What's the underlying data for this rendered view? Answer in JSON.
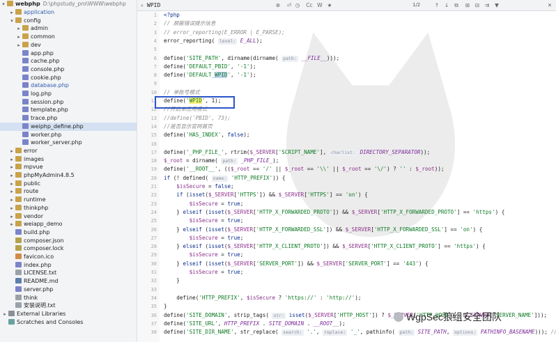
{
  "sidebar": {
    "root": {
      "name": "webphp",
      "path": "D:\\phpstudy_pro\\WWW\\webphp"
    },
    "items": [
      {
        "label": "application",
        "type": "folder",
        "depth": 1,
        "arrow": "▸",
        "blue": true
      },
      {
        "label": "config",
        "type": "folder",
        "depth": 1,
        "arrow": "▾",
        "blue": false
      },
      {
        "label": "admin",
        "type": "folder",
        "depth": 2,
        "arrow": "▸",
        "blue": false
      },
      {
        "label": "common",
        "type": "folder",
        "depth": 2,
        "arrow": "▸",
        "blue": false
      },
      {
        "label": "dev",
        "type": "folder",
        "depth": 2,
        "arrow": "▸",
        "blue": false
      },
      {
        "label": "app.php",
        "type": "php",
        "depth": 2,
        "arrow": "",
        "blue": false
      },
      {
        "label": "cache.php",
        "type": "php",
        "depth": 2,
        "arrow": "",
        "blue": false
      },
      {
        "label": "console.php",
        "type": "php",
        "depth": 2,
        "arrow": "",
        "blue": false
      },
      {
        "label": "cookie.php",
        "type": "php",
        "depth": 2,
        "arrow": "",
        "blue": false
      },
      {
        "label": "database.php",
        "type": "php",
        "depth": 2,
        "arrow": "",
        "blue": true
      },
      {
        "label": "log.php",
        "type": "php",
        "depth": 2,
        "arrow": "",
        "blue": false
      },
      {
        "label": "session.php",
        "type": "php",
        "depth": 2,
        "arrow": "",
        "blue": false
      },
      {
        "label": "template.php",
        "type": "php",
        "depth": 2,
        "arrow": "",
        "blue": false
      },
      {
        "label": "trace.php",
        "type": "php",
        "depth": 2,
        "arrow": "",
        "blue": false
      },
      {
        "label": "weiphp_define.php",
        "type": "php",
        "depth": 2,
        "arrow": "",
        "blue": false,
        "selected": true
      },
      {
        "label": "worker.php",
        "type": "php",
        "depth": 2,
        "arrow": "",
        "blue": false
      },
      {
        "label": "worker_server.php",
        "type": "php",
        "depth": 2,
        "arrow": "",
        "blue": false
      },
      {
        "label": "error",
        "type": "folder",
        "depth": 1,
        "arrow": "▸",
        "blue": false
      },
      {
        "label": "images",
        "type": "folder",
        "depth": 1,
        "arrow": "▸",
        "blue": false
      },
      {
        "label": "mpvue",
        "type": "folder",
        "depth": 1,
        "arrow": "▸",
        "blue": false
      },
      {
        "label": "phpMyAdmin4.8.5",
        "type": "folder",
        "depth": 1,
        "arrow": "▸",
        "blue": false
      },
      {
        "label": "public",
        "type": "folder",
        "depth": 1,
        "arrow": "▸",
        "blue": false
      },
      {
        "label": "route",
        "type": "folder",
        "depth": 1,
        "arrow": "▸",
        "blue": false
      },
      {
        "label": "runtime",
        "type": "folder",
        "depth": 1,
        "arrow": "▸",
        "blue": false
      },
      {
        "label": "thinkphp",
        "type": "folder",
        "depth": 1,
        "arrow": "▸",
        "blue": false
      },
      {
        "label": "vendor",
        "type": "folder",
        "depth": 1,
        "arrow": "▸",
        "blue": false
      },
      {
        "label": "weiapp_demo",
        "type": "folder",
        "depth": 1,
        "arrow": "▸",
        "blue": false
      },
      {
        "label": "build.php",
        "type": "php",
        "depth": 1,
        "arrow": "",
        "blue": false
      },
      {
        "label": "composer.json",
        "type": "json",
        "depth": 1,
        "arrow": "",
        "blue": false
      },
      {
        "label": "composer.lock",
        "type": "json",
        "depth": 1,
        "arrow": "",
        "blue": false
      },
      {
        "label": "favicon.ico",
        "type": "ico-file",
        "depth": 1,
        "arrow": "",
        "blue": false
      },
      {
        "label": "index.php",
        "type": "php",
        "depth": 1,
        "arrow": "",
        "blue": false
      },
      {
        "label": "LICENSE.txt",
        "type": "txt",
        "depth": 1,
        "arrow": "",
        "blue": false
      },
      {
        "label": "README.md",
        "type": "md",
        "depth": 1,
        "arrow": "",
        "blue": false
      },
      {
        "label": "server.php",
        "type": "php",
        "depth": 1,
        "arrow": "",
        "blue": false
      },
      {
        "label": "think",
        "type": "txt",
        "depth": 1,
        "arrow": "",
        "blue": false
      },
      {
        "label": "安装说明.txt",
        "type": "txt",
        "depth": 1,
        "arrow": "",
        "blue": false
      },
      {
        "label": "External Libraries",
        "type": "lib",
        "depth": 0,
        "arrow": "▸",
        "blue": false
      },
      {
        "label": "Scratches and Consoles",
        "type": "scratch",
        "depth": 0,
        "arrow": "",
        "blue": false
      }
    ]
  },
  "search": {
    "value": "WPID",
    "match_count": "1/2",
    "buttons": [
      "Cc",
      "W",
      "★"
    ]
  },
  "editor": {
    "lines": [
      {
        "n": "1",
        "html": "<span class='kw'>&lt;?php</span>"
      },
      {
        "n": "2",
        "html": "<span class='cmt'>// 屏蔽错误提示信息</span>"
      },
      {
        "n": "3",
        "html": "<span class='cmt'>// error_reporting(E_ERROR | E_PARSE);</span>"
      },
      {
        "n": "4",
        "html": "error_reporting( <span class='hint'>level:</span> <span class='const'>E_ALL</span>);"
      },
      {
        "n": "5",
        "html": ""
      },
      {
        "n": "6",
        "html": "define(<span class='str'>'SITE_PATH'</span>, dirname(dirname( <span class='hint'>path:</span> <span class='const'>__FILE__</span>)));"
      },
      {
        "n": "7",
        "html": "define(<span class='str'>'DEFAULT_PBID'</span>, <span class='str'>'-1'</span>);"
      },
      {
        "n": "8",
        "html": "define(<span class='str'>'DEFAULT_<span class=\"hl-word\">WPID</span>'</span>, <span class='str'>'-1'</span>);"
      },
      {
        "n": "9",
        "html": ""
      },
      {
        "n": "10",
        "html": "<span class='cmt'>// 单账号模式</span>"
      },
      {
        "n": "11",
        "html": "define(<span class='str'>'<span class=\"hl-match\">WPID</span>'</span>, 1);"
      },
      {
        "n": "12",
        "html": "<span class='cmt'>//开启单应用模式</span>"
      },
      {
        "n": "13",
        "html": "<span class='cmt'>//define('PBID', 73);</span>"
      },
      {
        "n": "14",
        "html": "<span class='cmt'>//是否显示官网首页</span>"
      },
      {
        "n": "15",
        "html": "define(<span class='str'>'HAS_INDEX'</span>, <span class='kw'>false</span>);"
      },
      {
        "n": "16",
        "html": ""
      },
      {
        "n": "17",
        "html": "define(<span class='str'>'_PHP_FILE_'</span>, rtrim(<span class='var'>$_SERVER</span>[<span class='str'>'SCRIPT_NAME'</span>], <span class='hint'>charlist:</span> <span class='const'>DIRECTORY_SEPARATOR</span>));"
      },
      {
        "n": "18",
        "html": "<span class='var'>$_root</span> = dirname( <span class='hint'>path:</span> <span class='const'>_PHP_FILE_</span>);"
      },
      {
        "n": "19",
        "html": "define(<span class='str'>'__ROOT__'</span>, ((<span class='var'>$_root</span> == <span class='str'>'/'</span> || <span class='var'>$_root</span> == <span class='str'>'\\\\'</span> || <span class='var'>$_root</span> == <span class='str'>'\\/'</span>) ? <span class='str'>''</span> : <span class='var'>$_root</span>));"
      },
      {
        "n": "20",
        "html": "<span class='kw'>if</span> (! defined( <span class='hint'>name:</span> <span class='str'>'HTTP_PREFIX'</span>)) {"
      },
      {
        "n": "21",
        "html": "    <span class='var'>$isSecure</span> = <span class='kw'>false</span>;"
      },
      {
        "n": "22",
        "html": "    <span class='kw'>if</span> (<span class='kw'>isset</span>(<span class='var'>$_SERVER</span>[<span class='str'>'HTTPS'</span>]) &amp;&amp; <span class='var'>$_SERVER</span>[<span class='str'>'HTTPS'</span>] == <span class='str'>'on'</span>) {"
      },
      {
        "n": "23",
        "html": "        <span class='var'>$isSecure</span> = <span class='kw'>true</span>;"
      },
      {
        "n": "24",
        "html": "    } <span class='kw'>elseif</span> (<span class='kw'>isset</span>(<span class='var'>$_SERVER</span>[<span class='str'>'HTTP_X_FORWARDED_PROTO'</span>]) &amp;&amp; <span class='var'>$_SERVER</span>[<span class='str'>'HTTP_X_FORWARDED_PROTO'</span>] == <span class='str'>'https'</span>) {"
      },
      {
        "n": "25",
        "html": "        <span class='var'>$isSecure</span> = <span class='kw'>true</span>;"
      },
      {
        "n": "26",
        "html": "    } <span class='kw'>elseif</span> (<span class='kw'>isset</span>(<span class='var'>$_SERVER</span>[<span class='str'>'HTTP_X_FORWARDED_SSL'</span>]) &amp;&amp; <span class='var'>$_SERVER</span>[<span class='str'>'HTTP_X_FORWARDED_SSL'</span>] == <span class='str'>'on'</span>) {"
      },
      {
        "n": "27",
        "html": "        <span class='var'>$isSecure</span> = <span class='kw'>true</span>;"
      },
      {
        "n": "28",
        "html": "    } <span class='kw'>elseif</span> (<span class='kw'>isset</span>(<span class='var'>$_SERVER</span>[<span class='str'>'HTTP_X_CLIENT_PROTO'</span>]) &amp;&amp; <span class='var'>$_SERVER</span>[<span class='str'>'HTTP_X_CLIENT_PROTO'</span>] == <span class='str'>'https'</span>) {"
      },
      {
        "n": "29",
        "html": "        <span class='var'>$isSecure</span> = <span class='kw'>true</span>;"
      },
      {
        "n": "30",
        "html": "    } <span class='kw'>elseif</span> (<span class='kw'>isset</span>(<span class='var'>$_SERVER</span>[<span class='str'>'SERVER_PORT'</span>]) &amp;&amp; <span class='var'>$_SERVER</span>[<span class='str'>'SERVER_PORT'</span>] == <span class='str'>'443'</span>) {"
      },
      {
        "n": "31",
        "html": "        <span class='var'>$isSecure</span> = <span class='kw'>true</span>;"
      },
      {
        "n": "32",
        "html": "    }"
      },
      {
        "n": "33",
        "html": ""
      },
      {
        "n": "34",
        "html": "    define(<span class='str'>'HTTP_PREFIX'</span>, <span class='var'>$isSecure</span> ? <span class='str'>'https://'</span> : <span class='str'>'http://'</span>);"
      },
      {
        "n": "35",
        "html": "}"
      },
      {
        "n": "36",
        "html": "define(<span class='str'>'SITE_DOMAIN'</span>, strip_tags( <span class='hint'>str:</span> <span class='kw'>isset</span>(<span class='var'>$_SERVER</span>[<span class='str'>'HTTP_HOST'</span>]) ? <span class='var'>$_SERVER</span>[<span class='str'>'HTTP_HOST'</span>] : <span class='var'>$_SERVER</span>[<span class='str'>'SERVER_NAME'</span>]));"
      },
      {
        "n": "37",
        "html": "define(<span class='str'>'SITE_URL'</span>, <span class='const'>HTTP_PREFIX</span> . <span class='const'>SITE_DOMAIN</span> . <span class='const'>__ROOT__</span>);"
      },
      {
        "n": "38",
        "html": "define(<span class='str'>'SITE_DIR_NAME'</span>, str_replace( <span class='hint'>search:</span> <span class='str'>'.'</span>, <span class='hint'>replace:</span> <span class='str'>'_'</span>, pathinfo( <span class='hint'>path:</span> <span class='const'>SITE_PATH</span>, <span class='hint'>options:</span> <span class='const'>PATHINFO_BASENAME</span>))); <span class='cmt'>// 网站</span>"
      }
    ]
  },
  "watermark": {
    "text": "WgpSec狼组安全团队"
  }
}
